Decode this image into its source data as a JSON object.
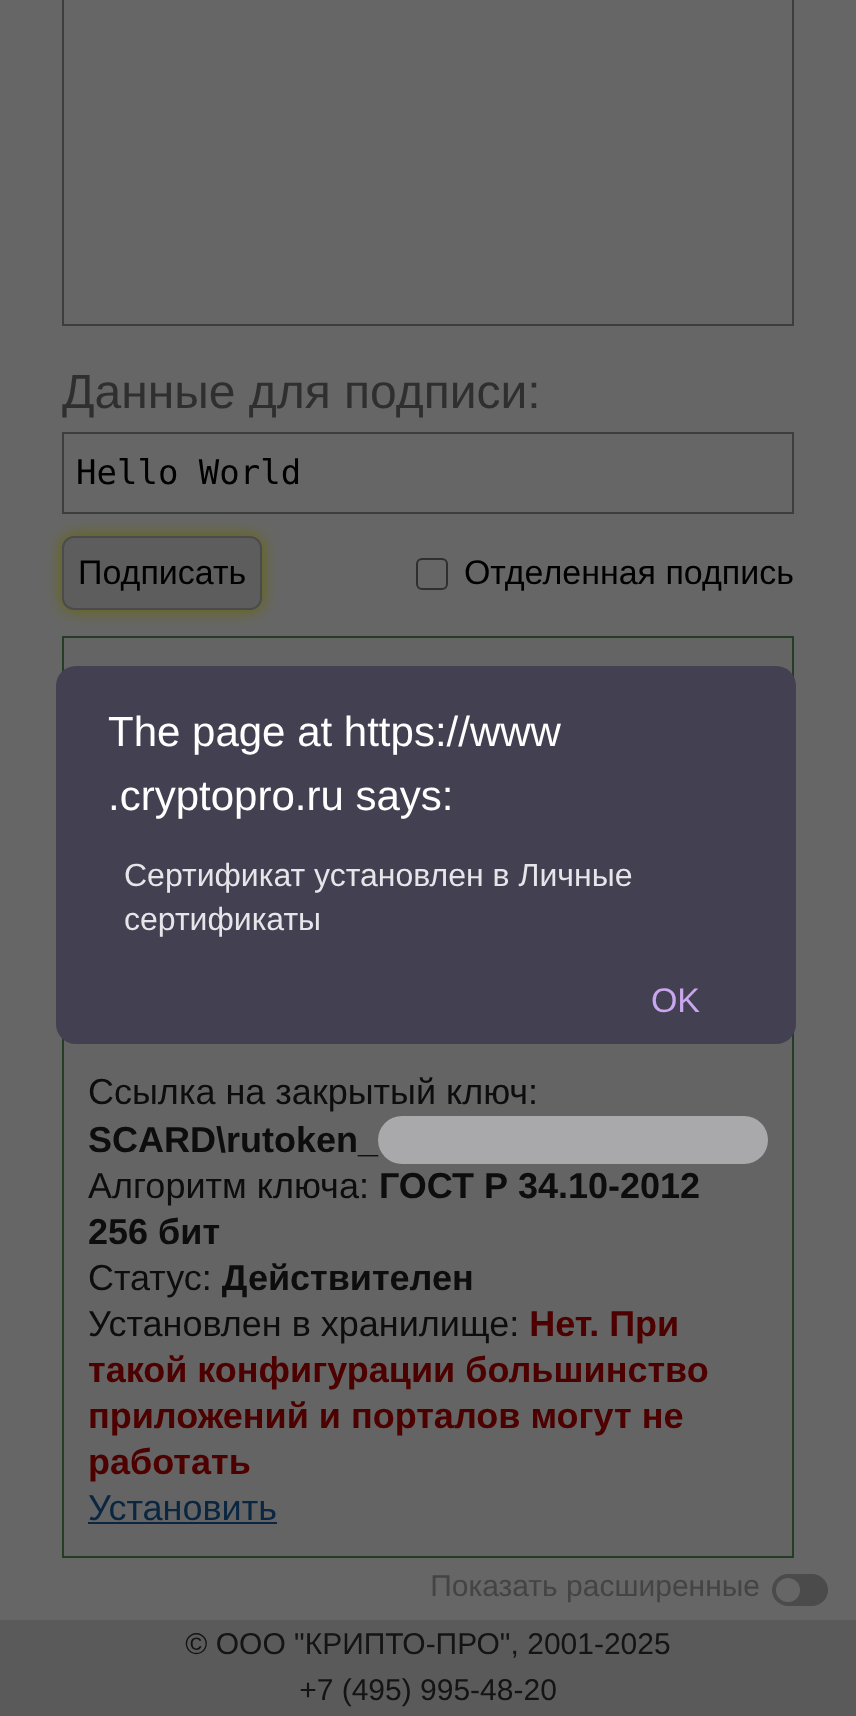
{
  "signing_data": {
    "heading": "Данные для подписи:",
    "value": "Hello World"
  },
  "sign_button": {
    "label": "Подписать"
  },
  "detached_signature": {
    "label": "Отделенная подпись",
    "checked": false
  },
  "certificate": {
    "fields": [
      {
        "label": "Ссылка на закрытый ключ: ",
        "value": "SCARD\\rutoken_",
        "kind": "redacted"
      },
      {
        "label": "Алгоритм ключа: ",
        "value": "ГОСТ Р 34.10-2012 256 бит",
        "kind": "normal"
      },
      {
        "label": "Статус: ",
        "value": "Действителен",
        "kind": "normal"
      },
      {
        "label": "Установлен в хранилище: ",
        "value": "Нет. При такой конфигурации большинство приложений и порталов могут не работать",
        "kind": "warning"
      }
    ],
    "install_link": "Установить"
  },
  "show_advanced": {
    "label": "Показать расширенные",
    "on": false
  },
  "footer": {
    "copyright": "© ООО \"КРИПТО-ПРО\", 2001-2025",
    "phone": "+7 (495) 995-48-20"
  },
  "dialog": {
    "title": "The page at https://www .cryptopro.ru says:",
    "message": "Сертификат установлен в Личные сертификаты",
    "ok": "OK"
  }
}
